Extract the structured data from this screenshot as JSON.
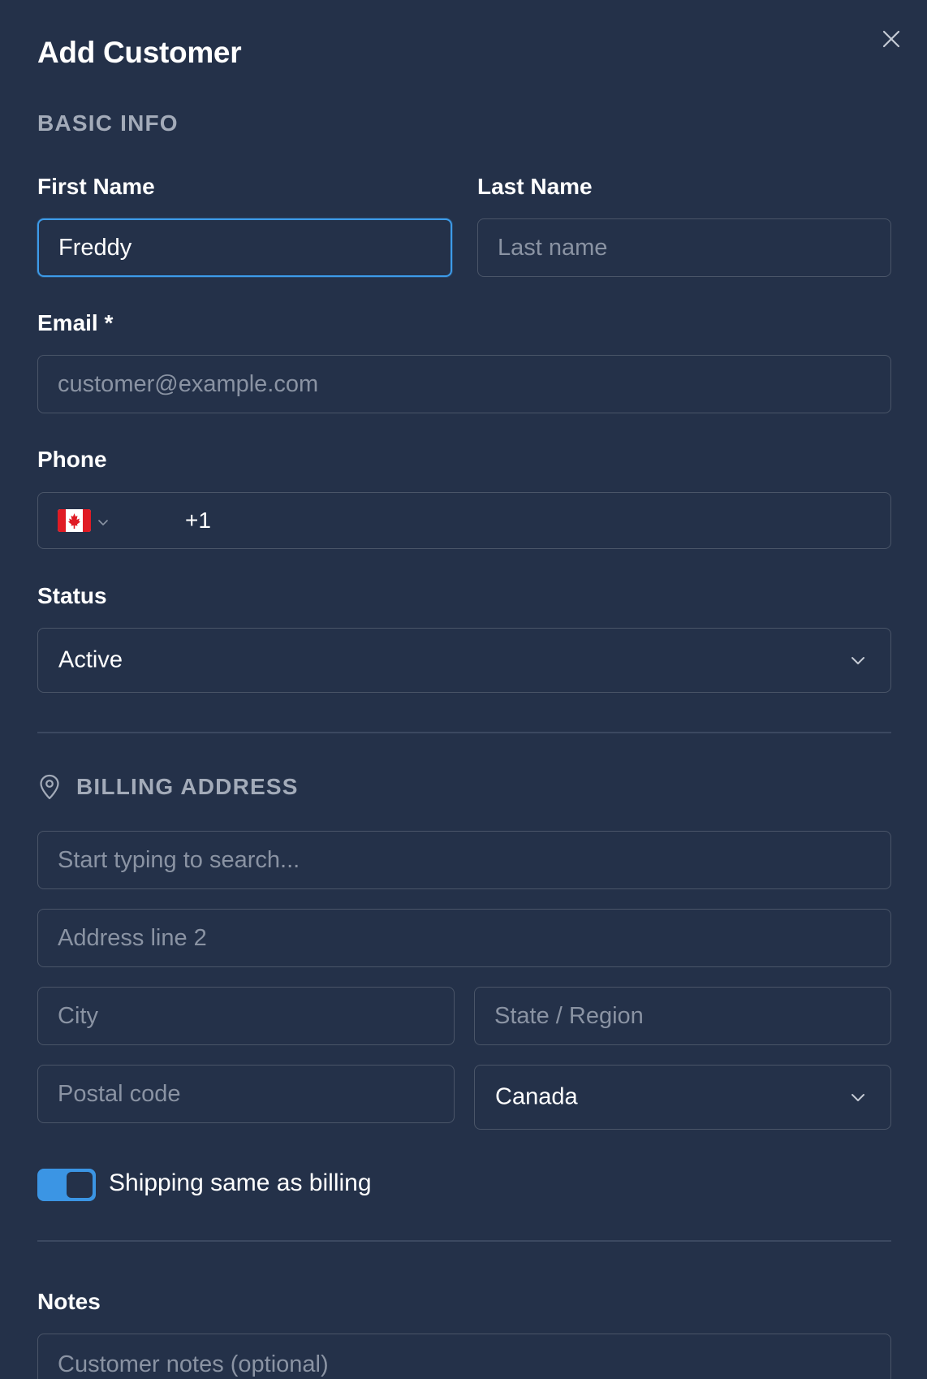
{
  "header": {
    "title": "Add Customer",
    "close_icon": "close-icon"
  },
  "basic_info": {
    "section_label": "BASIC INFO",
    "first_name": {
      "label": "First Name",
      "value": "Freddy",
      "placeholder": ""
    },
    "last_name": {
      "label": "Last Name",
      "value": "",
      "placeholder": "Last name"
    },
    "email": {
      "label": "Email *",
      "value": "",
      "placeholder": "customer@example.com"
    },
    "phone": {
      "label": "Phone",
      "country_flag": "canada-flag-icon",
      "dial_code": "+1"
    },
    "status": {
      "label": "Status",
      "selected": "Active"
    }
  },
  "billing": {
    "section_label": "BILLING ADDRESS",
    "section_icon": "map-pin-icon",
    "address_line1": {
      "placeholder": "Start typing to search..."
    },
    "address_line2": {
      "placeholder": "Address line 2"
    },
    "city": {
      "placeholder": "City"
    },
    "state": {
      "placeholder": "State / Region"
    },
    "postal_code": {
      "placeholder": "Postal code"
    },
    "country": {
      "selected": "Canada"
    }
  },
  "shipping_toggle": {
    "label": "Shipping same as billing",
    "checked": true
  },
  "notes": {
    "label": "Notes",
    "placeholder": "Customer notes (optional)"
  },
  "colors": {
    "background": "#243149",
    "accent": "#3b95e4",
    "border": "#4a5568",
    "muted_text": "#a3abb9",
    "placeholder": "#8a93a3"
  }
}
